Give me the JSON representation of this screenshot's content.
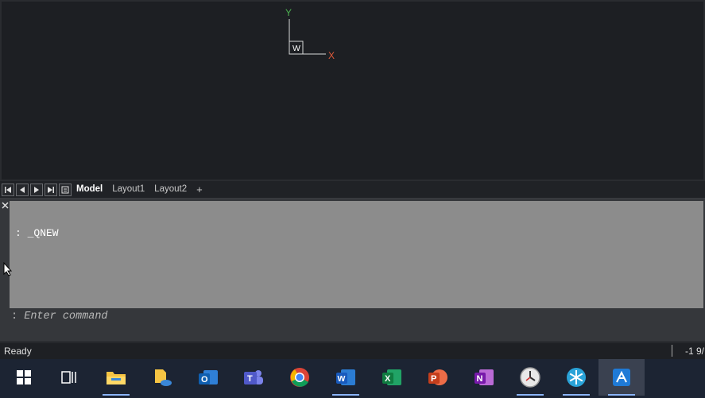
{
  "ucs": {
    "y_label": "Y",
    "x_label": "X",
    "w_label": "W"
  },
  "tabs": {
    "model": "Model",
    "layout1": "Layout1",
    "layout2": "Layout2",
    "add": "+"
  },
  "command": {
    "history_line": ": _QNEW",
    "prompt_prefix": ":",
    "placeholder": "Enter command"
  },
  "status": {
    "ready": "Ready",
    "coordinates": "-1 9/"
  },
  "taskbar": {
    "items": [
      "windows-start",
      "task-view",
      "file-explorer",
      "files",
      "outlook",
      "teams",
      "chrome",
      "word",
      "excel",
      "powerpoint",
      "onenote",
      "clock-app",
      "settings-snowflake",
      "cad-app"
    ]
  },
  "colors": {
    "axis_y": "#4caf50",
    "axis_x": "#e05a3a",
    "accent": "#8ab4f8"
  }
}
